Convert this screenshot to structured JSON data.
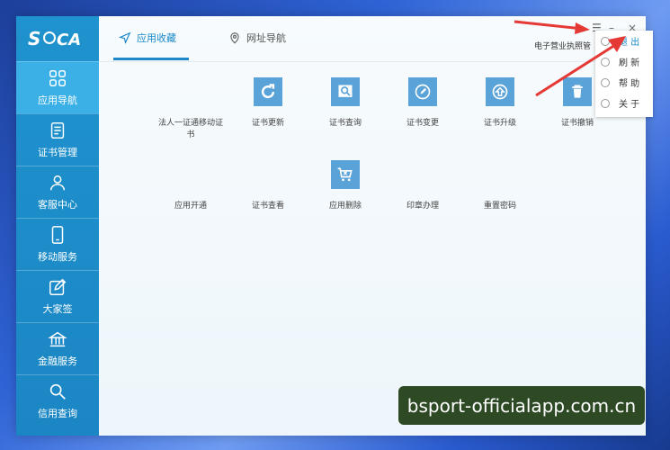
{
  "sidebar": {
    "logo_text": "SUECA",
    "items": [
      {
        "label": "应用导航",
        "icon": "grid-icon",
        "active": true
      },
      {
        "label": "证书管理",
        "icon": "certificate-icon"
      },
      {
        "label": "客服中心",
        "icon": "user-icon"
      },
      {
        "label": "移动服务",
        "icon": "phone-icon"
      },
      {
        "label": "大家签",
        "icon": "sign-icon"
      },
      {
        "label": "金融服务",
        "icon": "bank-icon"
      },
      {
        "label": "信用查询",
        "icon": "search-icon"
      }
    ]
  },
  "tabs": [
    {
      "label": "应用收藏",
      "icon": "send-icon"
    },
    {
      "label": "网址导航",
      "icon": "location-icon"
    }
  ],
  "header": {
    "user_text": "电子营业执照管"
  },
  "apps_row1": [
    {
      "label": "法人一证通移动证书",
      "icon": null
    },
    {
      "label": "证书更新",
      "icon": "refresh-icon"
    },
    {
      "label": "证书查询",
      "icon": "doc-search-icon"
    },
    {
      "label": "证书变更",
      "icon": "edit-icon"
    },
    {
      "label": "证书升级",
      "icon": "upgrade-icon"
    },
    {
      "label": "证书撤销",
      "icon": "trash-icon"
    }
  ],
  "apps_row2": [
    {
      "label": "应用开通",
      "icon": null
    },
    {
      "label": "证书查看",
      "icon": null
    },
    {
      "label": "应用删除",
      "icon": "cart-delete-icon"
    },
    {
      "label": "印章办理",
      "icon": null
    },
    {
      "label": "重置密码",
      "icon": null
    }
  ],
  "menu": {
    "items": [
      {
        "label": "退 出"
      },
      {
        "label": "刷 新"
      },
      {
        "label": "帮 助"
      },
      {
        "label": "关 于"
      }
    ]
  },
  "watermark": "bsport-officialapp.com.cn",
  "colors": {
    "accent": "#1a88c9",
    "sidebar": "#1f93cf",
    "icon_tile": "#5aa3d8",
    "arrow": "#e53935"
  }
}
